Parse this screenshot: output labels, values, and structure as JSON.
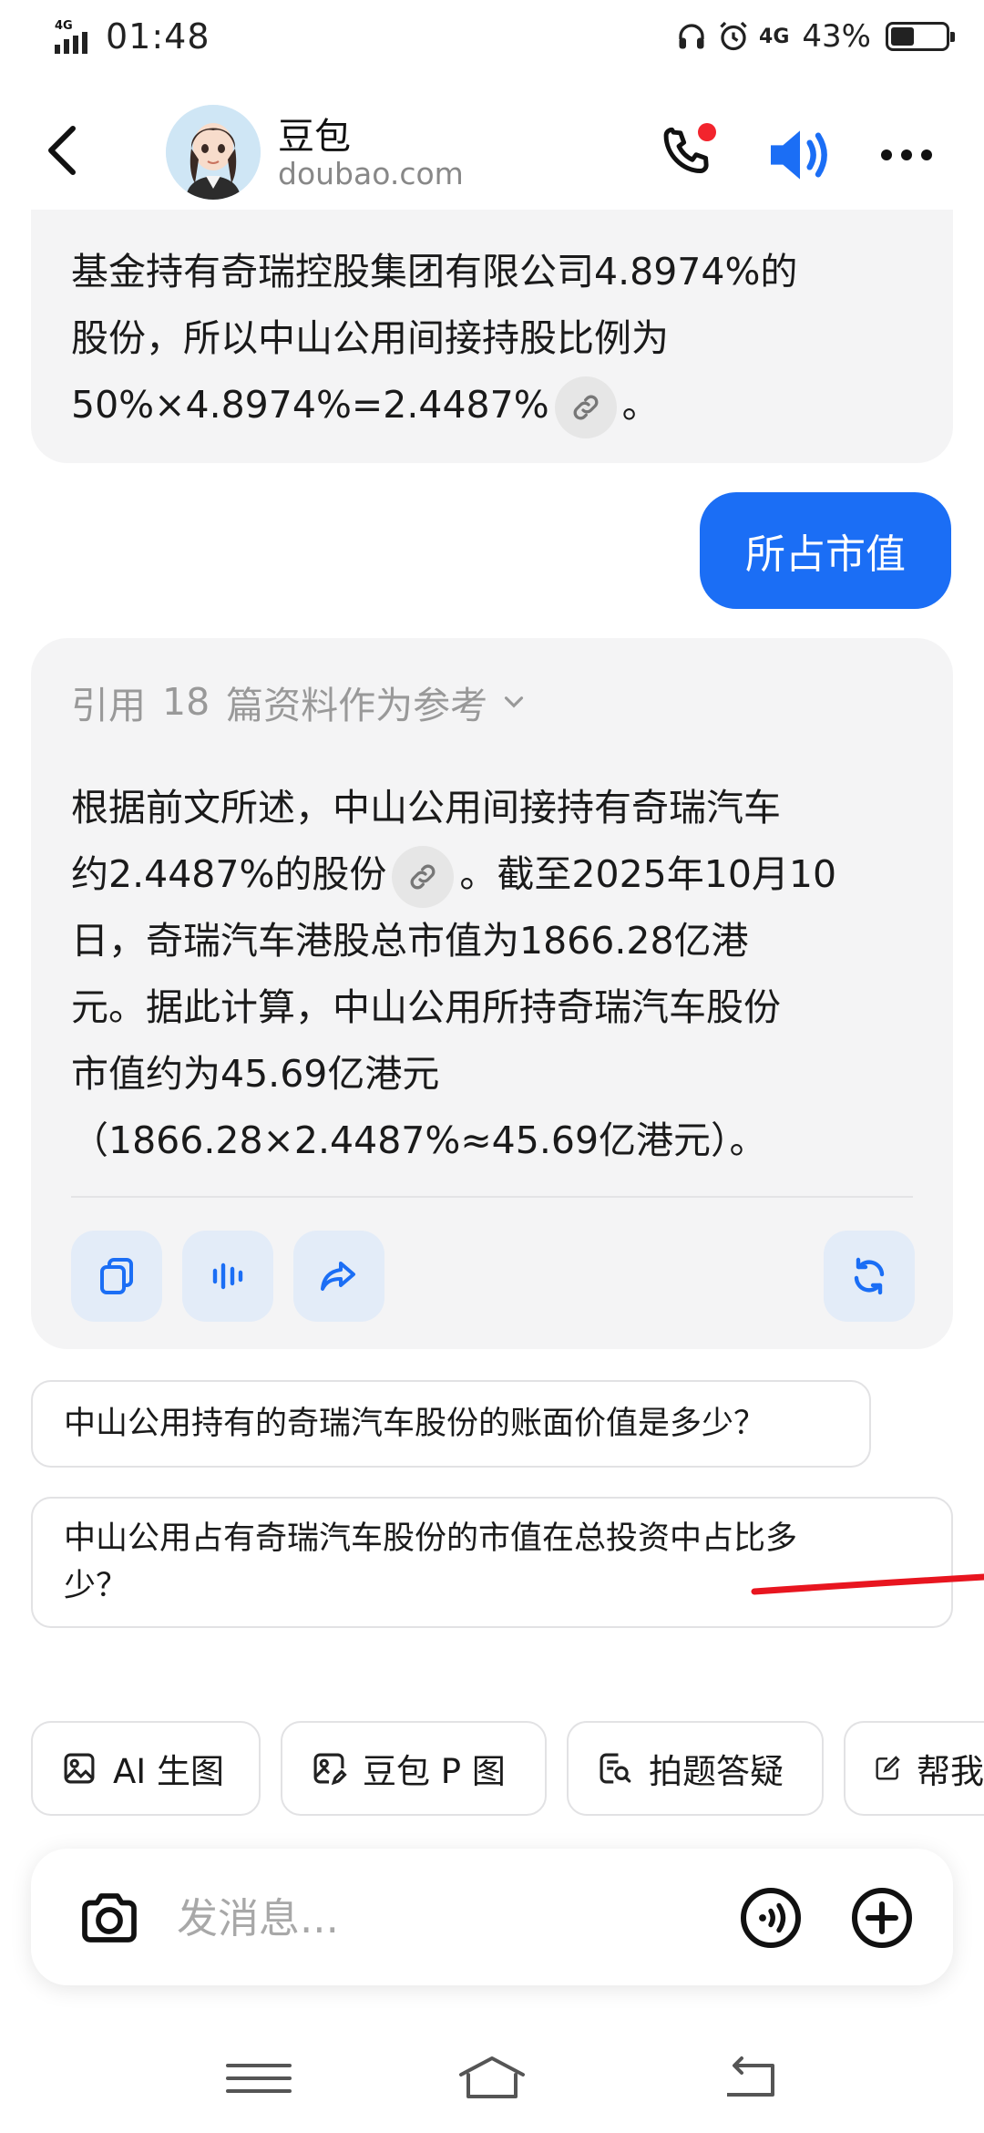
{
  "status_bar": {
    "network": "4G",
    "time": "01:48",
    "network2": "4G",
    "battery_percent": "43%",
    "battery_level": 0.43
  },
  "header": {
    "back_icon": "chevron-left-icon",
    "bot_name": "豆包",
    "bot_domain": "doubao.com",
    "call_icon": "phone-icon",
    "speaker_icon": "speaker-icon",
    "more_icon": "more-dots-icon"
  },
  "chat": {
    "bot_message_1": {
      "line1": "基金持有奇瑞控股集团有限公司4.8974%的",
      "line2": "股份，所以中山公用间接持股比例为",
      "line3": "50%×4.8974%=2.4487%",
      "line3_end": "。"
    },
    "user_message": "所占市值",
    "bot_message_2": {
      "ref_prefix": "引用",
      "ref_count": "18",
      "ref_suffix": "篇资料作为参考",
      "line1": "根据前文所述，中山公用间接持有奇瑞汽车",
      "line2": "约2.4487%的股份",
      "line2_end": "。截至2025年10月10",
      "line3": "日，奇瑞汽车港股总市值为1866.28亿港",
      "line4": "元。据此计算，中山公用所持奇瑞汽车股份",
      "line5": "市值约为45.69亿港元",
      "line6": "（1866.28×2.4487%≈45.69亿港元）。"
    },
    "actions": [
      "copy-icon",
      "audio-wave-icon",
      "share-icon",
      "refresh-icon"
    ]
  },
  "suggestions": [
    "中山公用持有的奇瑞汽车股份的账面价值是多少？",
    "中山公用占有奇瑞汽车股份的市值在总投资中占比多",
    "少？"
  ],
  "tools": [
    {
      "label": "AI 生图",
      "icon": "image-icon"
    },
    {
      "label": "豆包 P 图",
      "icon": "image-edit-icon"
    },
    {
      "label": "拍题答疑",
      "icon": "scan-question-icon"
    },
    {
      "label": "帮我",
      "icon": "edit-icon"
    }
  ],
  "input": {
    "placeholder": "发消息..."
  },
  "accent_color": "#1b6ef5"
}
